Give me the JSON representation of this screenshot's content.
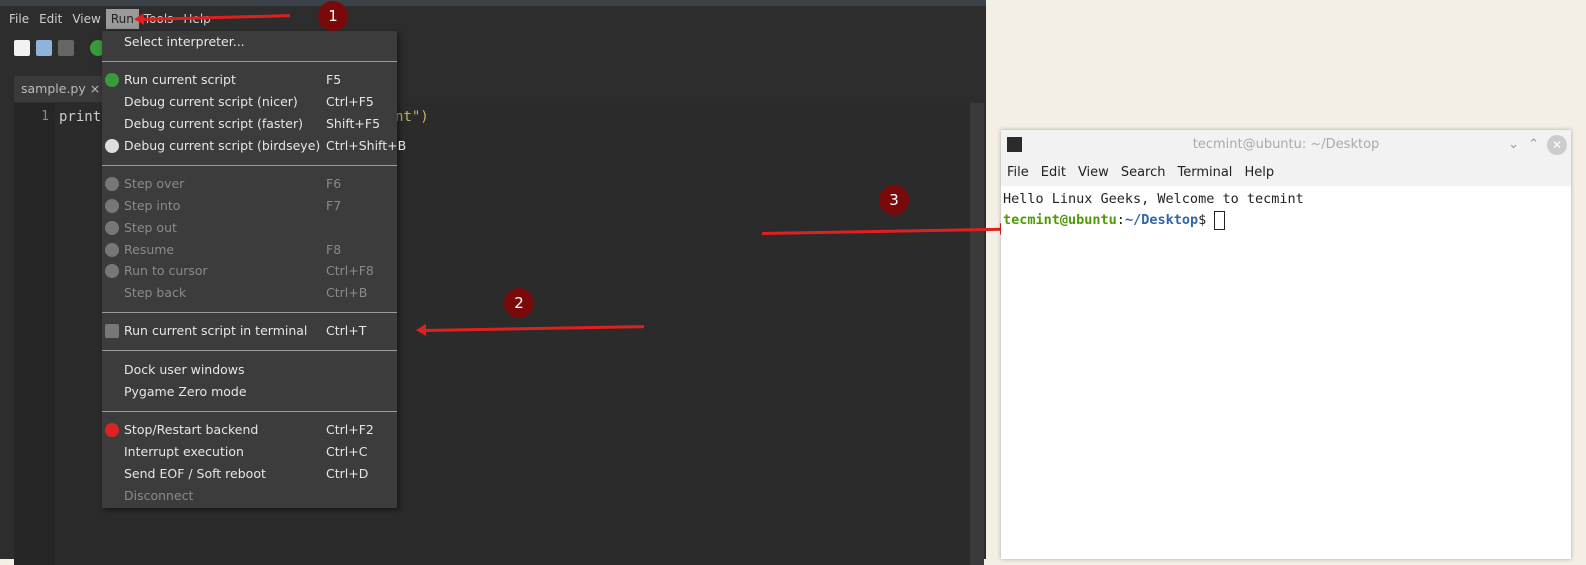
{
  "ide": {
    "menubar": [
      "File",
      "Edit",
      "View",
      "Run",
      "Tools",
      "Help"
    ],
    "active_menu": "Run",
    "tab": "sample.py",
    "tab_close": "×",
    "line_number": "1",
    "code_start": "print(",
    "code_end": "nt\")"
  },
  "run_menu": {
    "items": [
      {
        "label": "Select interpreter...",
        "shortcut": "",
        "icon": "",
        "disabled": false
      },
      {
        "label": "Run current script",
        "shortcut": "F5",
        "icon": "run-icon",
        "disabled": false
      },
      {
        "label": "Debug current script (nicer)",
        "shortcut": "Ctrl+F5",
        "icon": "",
        "disabled": false
      },
      {
        "label": "Debug current script (faster)",
        "shortcut": "Shift+F5",
        "icon": "",
        "disabled": false
      },
      {
        "label": "Debug current script (birdseye)",
        "shortcut": "Ctrl+Shift+B",
        "icon": "birdseye-icon",
        "disabled": false
      },
      {
        "label": "Step over",
        "shortcut": "F6",
        "icon": "step-over-icon",
        "disabled": true
      },
      {
        "label": "Step into",
        "shortcut": "F7",
        "icon": "step-into-icon",
        "disabled": true
      },
      {
        "label": "Step out",
        "shortcut": "",
        "icon": "step-out-icon",
        "disabled": true
      },
      {
        "label": "Resume",
        "shortcut": "F8",
        "icon": "resume-icon",
        "disabled": true
      },
      {
        "label": "Run to cursor",
        "shortcut": "Ctrl+F8",
        "icon": "run-to-cursor-icon",
        "disabled": true
      },
      {
        "label": "Step back",
        "shortcut": "Ctrl+B",
        "icon": "",
        "disabled": true
      },
      {
        "label": "Run current script in terminal",
        "shortcut": "Ctrl+T",
        "icon": "terminal-icon",
        "disabled": false
      },
      {
        "label": "Dock user windows",
        "shortcut": "",
        "icon": "",
        "disabled": false
      },
      {
        "label": "Pygame Zero mode",
        "shortcut": "",
        "icon": "",
        "disabled": false
      },
      {
        "label": "Stop/Restart backend",
        "shortcut": "Ctrl+F2",
        "icon": "stop-icon",
        "disabled": false
      },
      {
        "label": "Interrupt execution",
        "shortcut": "Ctrl+C",
        "icon": "",
        "disabled": false
      },
      {
        "label": "Send EOF / Soft reboot",
        "shortcut": "Ctrl+D",
        "icon": "",
        "disabled": false
      },
      {
        "label": "Disconnect",
        "shortcut": "",
        "icon": "",
        "disabled": true
      }
    ]
  },
  "annotations": [
    "1",
    "2",
    "3"
  ],
  "terminal": {
    "title": "tecmint@ubuntu: ~/Desktop",
    "menu": [
      "File",
      "Edit",
      "View",
      "Search",
      "Terminal",
      "Help"
    ],
    "output": "Hello Linux Geeks, Welcome to tecmint",
    "prompt_user": "tecmint@ubuntu",
    "prompt_sep": ":",
    "prompt_path": "~/Desktop",
    "prompt_end": "$ "
  }
}
